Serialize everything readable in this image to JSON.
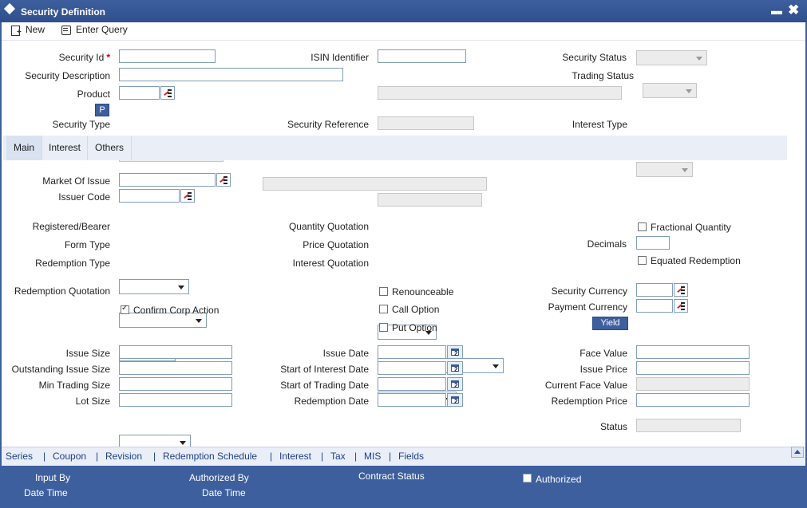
{
  "window": {
    "title": "Security Definition"
  },
  "toolbar": {
    "new_label": "New",
    "enter_query_label": "Enter Query"
  },
  "header": {
    "security_id_label": "Security Id",
    "required_mark": "*",
    "isin_label": "ISIN Identifier",
    "security_status_label": "Security Status",
    "security_description_label": "Security Description",
    "trading_status_label": "Trading Status",
    "product_label": "Product",
    "p_button_label": "P",
    "security_type_label": "Security Type",
    "security_reference_label": "Security Reference",
    "interest_type_label": "Interest Type"
  },
  "tabs": [
    {
      "label": "Main"
    },
    {
      "label": "Interest"
    },
    {
      "label": "Others"
    }
  ],
  "main": {
    "market_of_issue_label": "Market Of Issue",
    "issuer_code_label": "Issuer Code",
    "registered_bearer_label": "Registered/Bearer",
    "form_type_label": "Form Type",
    "redemption_type_label": "Redemption Type",
    "quantity_quotation_label": "Quantity Quotation",
    "price_quotation_label": "Price Quotation",
    "interest_quotation_label": "Interest Quotation",
    "fractional_quantity_label": "Fractional Quantity",
    "decimals_label": "Decimals",
    "equated_redemption_label": "Equated Redemption",
    "redemption_quotation_label": "Redemption Quotation",
    "confirm_corp_action_label": "Confirm Corp Action",
    "confirm_corp_action_checked": true,
    "renounceable_label": "Renounceable",
    "call_option_label": "Call Option",
    "put_option_label": "Put Option",
    "security_currency_label": "Security Currency",
    "payment_currency_label": "Payment Currency",
    "yield_button_label": "Yield",
    "issue_size_label": "Issue Size",
    "outstanding_issue_size_label": "Outstanding Issue Size",
    "min_trading_size_label": "Min Trading Size",
    "lot_size_label": "Lot Size",
    "issue_date_label": "Issue Date",
    "start_of_interest_date_label": "Start of Interest Date",
    "start_of_trading_date_label": "Start of Trading Date",
    "redemption_date_label": "Redemption Date",
    "face_value_label": "Face Value",
    "issue_price_label": "Issue Price",
    "current_face_value_label": "Current Face Value",
    "redemption_price_label": "Redemption Price",
    "status_label": "Status"
  },
  "links": [
    "Series",
    "Coupon",
    "Revision",
    "Redemption Schedule",
    "Interest",
    "Tax",
    "MIS",
    "Fields"
  ],
  "links_separator": "|",
  "footer": {
    "input_by_label": "Input By",
    "date_time_label_1": "Date Time",
    "authorized_by_label": "Authorized By",
    "date_time_label_2": "Date Time",
    "contract_status_label": "Contract Status",
    "authorized_label": "Authorized"
  }
}
